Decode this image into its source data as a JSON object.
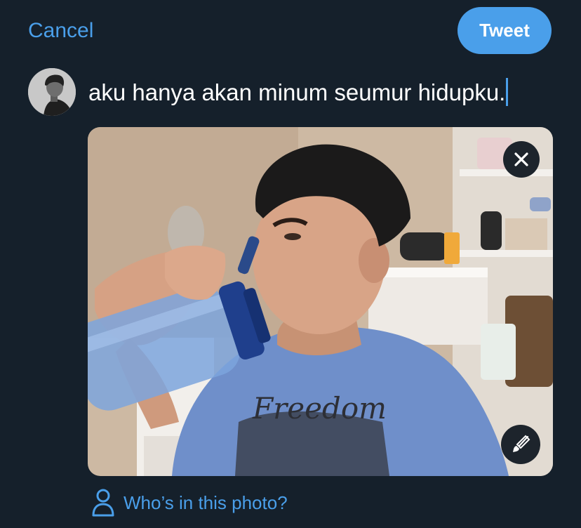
{
  "header": {
    "cancel_label": "Cancel",
    "tweet_label": "Tweet"
  },
  "composer": {
    "text": "aku hanya akan minum seumur hidupku."
  },
  "media": {
    "shirt_print_text": "Freedom",
    "tag_people_label": "Who’s in this photo?"
  },
  "colors": {
    "background": "#15202b",
    "accent": "#4a9fea",
    "text": "#ffffff",
    "overlay_button": "#1d242c"
  },
  "icons": {
    "remove": "close-icon",
    "edit": "brush-icon",
    "tag": "person-icon"
  }
}
